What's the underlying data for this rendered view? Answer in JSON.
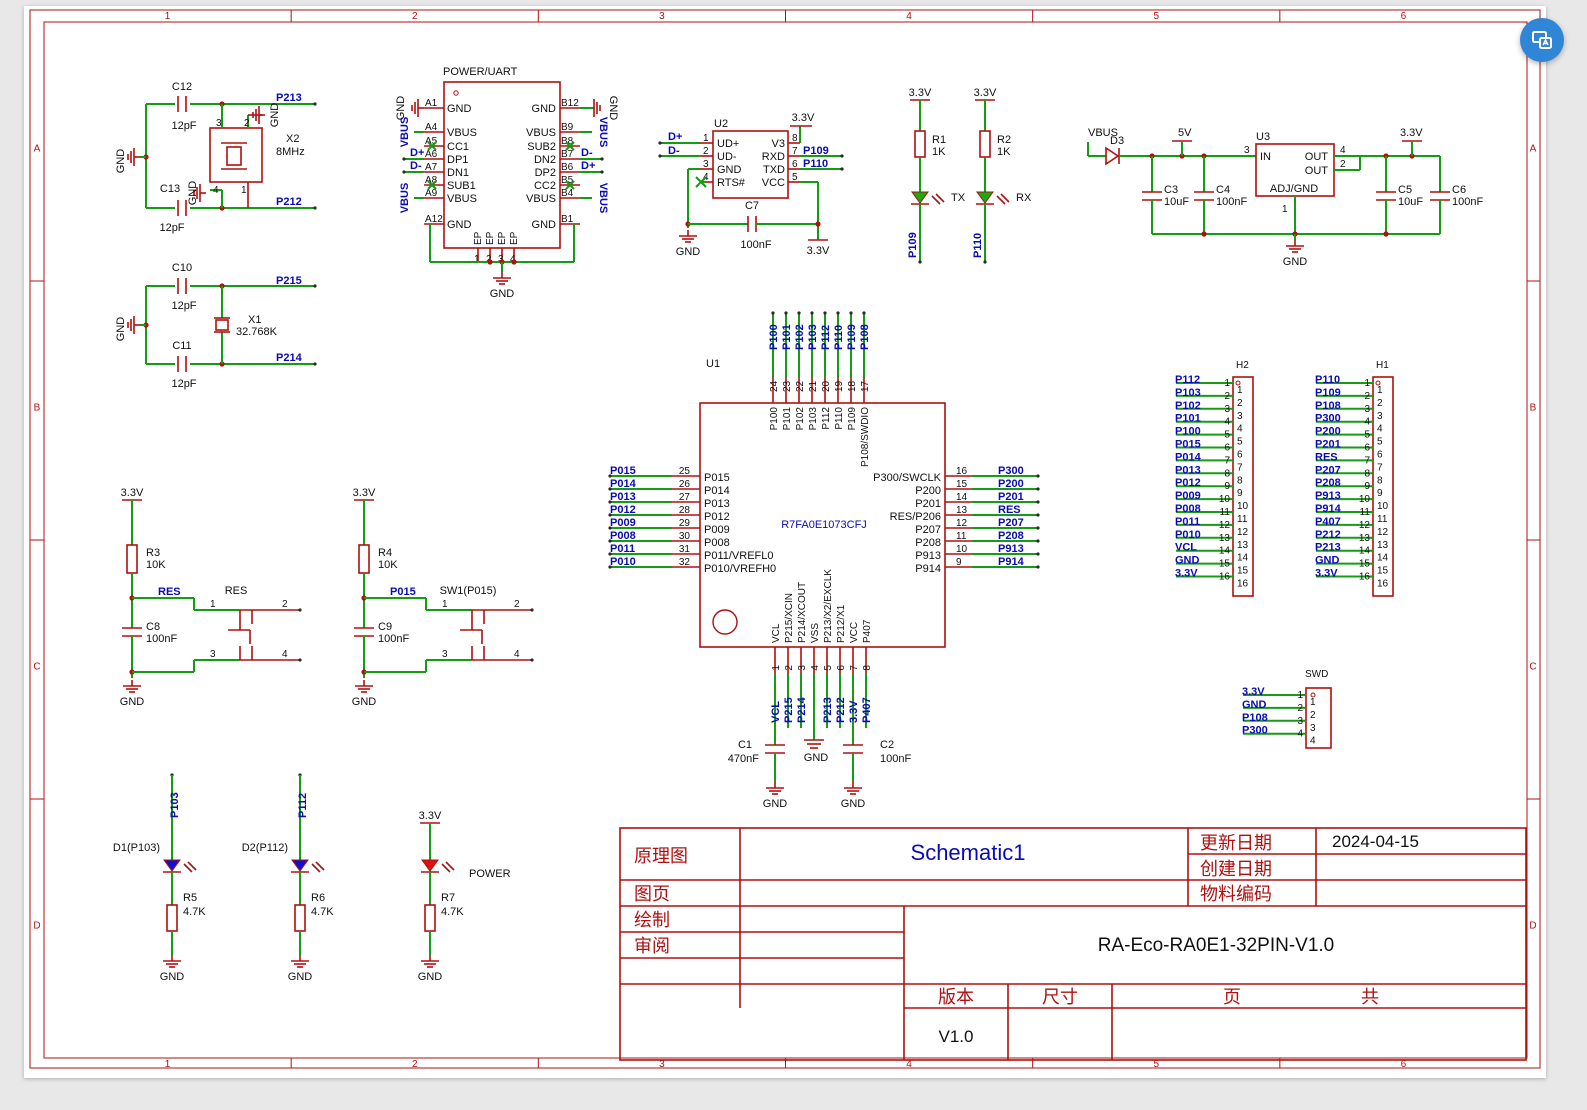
{
  "sheet_title": "Schematic1",
  "project": "RA-Eco-RA0E1-32PIN-V1.0",
  "title_block": {
    "principle_label": "原理图",
    "page_label": "图页",
    "drawn_label": "绘制",
    "review_label": "审阅",
    "update_label": "更新日期",
    "update_value": "2024-04-15",
    "create_label": "创建日期",
    "material_label": "物料编码",
    "version_label": "版本",
    "version_value": "V1.0",
    "size_label": "尺寸",
    "pages_label": "页",
    "total_label": "共"
  },
  "border": {
    "cols": [
      "1",
      "2",
      "3",
      "4",
      "5",
      "6"
    ],
    "rows": [
      "A",
      "B",
      "C",
      "D"
    ]
  },
  "mcu": {
    "ref": "U1",
    "part": "R7FA0E1073CFJ",
    "top": [
      [
        "24",
        "P100"
      ],
      [
        "23",
        "P101"
      ],
      [
        "22",
        "P102"
      ],
      [
        "21",
        "P103"
      ],
      [
        "20",
        "P112"
      ],
      [
        "19",
        "P110"
      ],
      [
        "18",
        "P109"
      ],
      [
        "17",
        "P108/SWDIO"
      ]
    ],
    "top_nets": [
      "P100",
      "P101",
      "P102",
      "P103",
      "P112",
      "P110",
      "P109",
      "P108"
    ],
    "left": [
      [
        "25",
        "P015",
        "P015"
      ],
      [
        "26",
        "P014",
        "P014"
      ],
      [
        "27",
        "P013",
        "P013"
      ],
      [
        "28",
        "P012",
        "P012"
      ],
      [
        "29",
        "P009",
        "P009"
      ],
      [
        "30",
        "P008",
        "P008"
      ],
      [
        "31",
        "P011/VREFL0",
        "P011"
      ],
      [
        "32",
        "P010/VREFH0",
        "P010"
      ]
    ],
    "right": [
      [
        "16",
        "P300/SWCLK",
        "P300"
      ],
      [
        "15",
        "P200",
        "P200"
      ],
      [
        "14",
        "P201",
        "P201"
      ],
      [
        "13",
        "RES/P206",
        "RES"
      ],
      [
        "12",
        "P207",
        "P207"
      ],
      [
        "11",
        "P208",
        "P208"
      ],
      [
        "10",
        "P913",
        "P913"
      ],
      [
        "9",
        "P914",
        "P914"
      ]
    ],
    "bottom": [
      [
        "1",
        "VCL",
        "VCL"
      ],
      [
        "2",
        "P215/XCIN",
        "P215"
      ],
      [
        "3",
        "P214/XCOUT",
        "P214"
      ],
      [
        "4",
        "VSS",
        ""
      ],
      [
        "5",
        "P213/X2/EXCLK",
        "P213"
      ],
      [
        "6",
        "P212/X1",
        "P212"
      ],
      [
        "7",
        "VCC",
        "3.3V"
      ],
      [
        "8",
        "P407",
        "P407"
      ]
    ]
  },
  "usb": {
    "title": "POWER/UART",
    "left_pins": [
      "A1",
      "A4",
      "A5",
      "A6",
      "A7",
      "A8",
      "A9",
      "A12"
    ],
    "left_names": [
      "GND",
      "VBUS",
      "CC1",
      "DP1",
      "DN1",
      "SUB1",
      "VBUS",
      "GND"
    ],
    "right_pins": [
      "B12",
      "B9",
      "B8",
      "B7",
      "B6",
      "B5",
      "B4",
      "B1"
    ],
    "right_names": [
      "GND",
      "VBUS",
      "SUB2",
      "DN2",
      "DP2",
      "CC2",
      "VBUS",
      "GND"
    ],
    "bottom_pins": [
      "1",
      "2",
      "3",
      "4"
    ],
    "bottom_names": [
      "EP",
      "EP",
      "EP",
      "EP"
    ],
    "nets": {
      "dplus": "D+",
      "dminus": "D-",
      "vbus": "VBUS",
      "gnd": "GND"
    }
  },
  "u2": {
    "ref": "U2",
    "left": [
      [
        "1",
        "UD+"
      ],
      [
        "2",
        "UD-"
      ],
      [
        "3",
        "GND"
      ],
      [
        "4",
        "RTS#"
      ]
    ],
    "right": [
      [
        "8",
        "V3"
      ],
      [
        "7",
        "RXD"
      ],
      [
        "6",
        "TXD"
      ],
      [
        "5",
        "VCC"
      ]
    ],
    "nets": [
      "D+",
      "D-",
      "P109",
      "P110",
      "3.3V",
      "GND"
    ],
    "cap": [
      "C7",
      "100nF"
    ]
  },
  "leds_uart": [
    {
      "r": "R1",
      "rv": "1K",
      "label": "TX",
      "net": "P109",
      "pwr": "3.3V"
    },
    {
      "r": "R2",
      "rv": "1K",
      "label": "RX",
      "net": "P110",
      "pwr": "3.3V"
    }
  ],
  "ldo": {
    "ref": "U3",
    "in": "IN",
    "out1": "OUT",
    "out2": "OUT",
    "adj": "ADJ/GND",
    "pins": [
      "3",
      "4",
      "2",
      "1"
    ],
    "diode": "D3",
    "vbus": "VBUS",
    "v5": "5V",
    "v33": "3.3V",
    "gnd": "GND",
    "caps": [
      [
        "C3",
        "10uF"
      ],
      [
        "C4",
        "100nF"
      ],
      [
        "C5",
        "10uF"
      ],
      [
        "C6",
        "100nF"
      ]
    ]
  },
  "xtal_hf": {
    "ref": "X2",
    "value": "8MHz",
    "c1": [
      "C12",
      "12pF"
    ],
    "c2": [
      "C13",
      "12pF"
    ],
    "net1": "P213",
    "net2": "P212",
    "gnd": "GND",
    "pins": [
      "3",
      "2",
      "4",
      "1"
    ]
  },
  "xtal_lf": {
    "ref": "X1",
    "value": "32.768K",
    "c1": [
      "C10",
      "12pF"
    ],
    "c2": [
      "C11",
      "12pF"
    ],
    "net1": "P215",
    "net2": "P214",
    "gnd": "GND"
  },
  "reset": {
    "pwr": "3.3V",
    "r": "R3",
    "rv": "10K",
    "c": "C8",
    "cv": "100nF",
    "net": "RES",
    "sw": "RES",
    "gnd": "GND",
    "pins": [
      "1",
      "2",
      "3",
      "4"
    ]
  },
  "sw1": {
    "pwr": "3.3V",
    "r": "R4",
    "rv": "10K",
    "c": "C9",
    "cv": "100nF",
    "net": "P015",
    "sw": "SW1(P015)",
    "gnd": "GND",
    "pins": [
      "1",
      "2",
      "3",
      "4"
    ]
  },
  "leds": [
    {
      "d": "D1(P103)",
      "net": "P103",
      "r": "R5",
      "rv": "4.7K",
      "gnd": "GND"
    },
    {
      "d": "D2(P112)",
      "net": "P112",
      "r": "R6",
      "rv": "4.7K",
      "gnd": "GND"
    },
    {
      "d": "POWER",
      "net": "3.3V",
      "r": "R7",
      "rv": "4.7K",
      "gnd": "GND"
    }
  ],
  "decoup": {
    "c1": [
      "C1",
      "470nF"
    ],
    "c2": [
      "C2",
      "100nF"
    ],
    "gnd": "GND"
  },
  "h2": {
    "ref": "H2",
    "nets": [
      "P112",
      "P103",
      "P102",
      "P101",
      "P100",
      "P015",
      "P014",
      "P013",
      "P012",
      "P009",
      "P008",
      "P011",
      "P010",
      "VCL",
      "GND",
      "3.3V"
    ]
  },
  "h1": {
    "ref": "H1",
    "nets": [
      "P110",
      "P109",
      "P108",
      "P300",
      "P200",
      "P201",
      "RES",
      "P207",
      "P208",
      "P913",
      "P914",
      "P407",
      "P212",
      "P213",
      "GND",
      "3.3V"
    ]
  },
  "swd": {
    "ref": "SWD",
    "nets": [
      "3.3V",
      "GND",
      "P108",
      "P300"
    ]
  },
  "colors": {
    "wire": "#149c14",
    "part": "#b01010",
    "net": "#0a0ab8",
    "border": "#b01010",
    "fab": "#2f86d6"
  },
  "icons": {
    "fab": "translate-screen-icon"
  }
}
